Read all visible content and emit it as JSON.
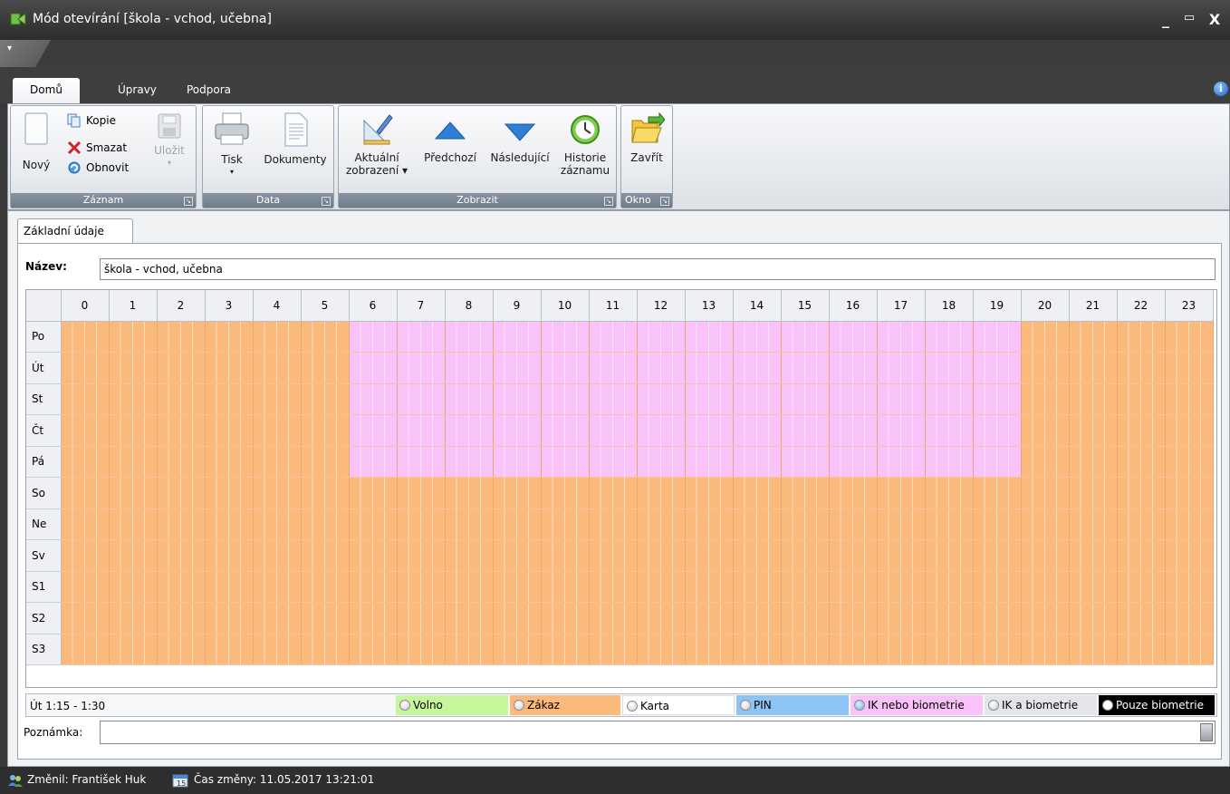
{
  "window": {
    "title": "Mód otevírání [škola - vchod, učebna]",
    "minimize": "_",
    "maximize": "▭",
    "close": "X"
  },
  "qat": {
    "menu": "▾"
  },
  "ribbon_tabs": [
    "Domů",
    "Úpravy",
    "Podpora"
  ],
  "info_icon": "i",
  "ribbon": {
    "zaznam": {
      "label": "Záznam",
      "novy": "Nový",
      "kopie": "Kopie",
      "smazat": "Smazat",
      "obnovit": "Obnovit",
      "ulozit": "Uložit"
    },
    "data": {
      "label": "Data",
      "tisk": "Tisk",
      "dokumenty": "Dokumenty"
    },
    "zobrazit": {
      "label": "Zobrazit",
      "aktualni_1": "Aktuální",
      "aktualni_2": "zobrazení ▾",
      "predchozi": "Předchozí",
      "nasledujici": "Následující",
      "historie_1": "Historie",
      "historie_2": "záznamu"
    },
    "okno": {
      "label": "Okno",
      "zavrit": "Zavřít"
    }
  },
  "doc_tab": "Základní údaje",
  "form": {
    "name_label": "Název:",
    "name_value": "škola - vchod, učebna",
    "note_label": "Poznámka:"
  },
  "schedule": {
    "hours": [
      "0",
      "1",
      "2",
      "3",
      "4",
      "5",
      "6",
      "7",
      "8",
      "9",
      "10",
      "11",
      "12",
      "13",
      "14",
      "15",
      "16",
      "17",
      "18",
      "19",
      "20",
      "21",
      "22",
      "23"
    ],
    "days": [
      "Po",
      "Út",
      "St",
      "Čt",
      "Pá",
      "So",
      "Ne",
      "Sv",
      "S1",
      "S2",
      "S3"
    ],
    "ik_days": [
      "Po",
      "Út",
      "St",
      "Čt",
      "Pá"
    ],
    "ik_hour_from": 6,
    "ik_hour_to": 19
  },
  "status": {
    "current": "Út 1:15 - 1:30"
  },
  "legend": [
    {
      "label": "Volno",
      "color": "#c6f59a"
    },
    {
      "label": "Zákaz",
      "color": "#fbb97c"
    },
    {
      "label": "Karta",
      "color": "#ffffff"
    },
    {
      "label": "PIN",
      "color": "#8ec3f5"
    },
    {
      "label": "IK nebo biometrie",
      "color": "#f9c2f8"
    },
    {
      "label": "IK a biometrie",
      "color": "#e3e5e8"
    },
    {
      "label": "Pouze biometrie",
      "color": "#000000"
    }
  ],
  "footer": {
    "changed_by": "Změnil: František Huk",
    "changed_at": "Čas změny: 11.05.2017 13:21:01"
  }
}
